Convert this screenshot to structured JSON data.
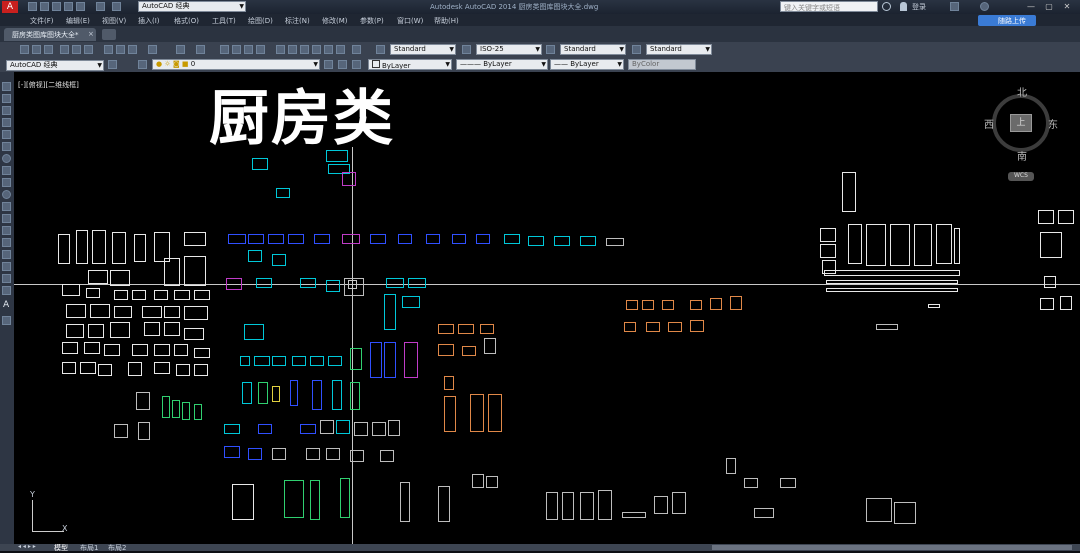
{
  "titlebar": {
    "workspace": "AutoCAD 经典",
    "title": "Autodesk AutoCAD 2014   厨房类图库图块大全.dwg",
    "search_placeholder": "键入关键字或短语",
    "login": "登录"
  },
  "menubar": {
    "items": [
      "文件(F)",
      "编辑(E)",
      "视图(V)",
      "插入(I)",
      "格式(O)",
      "工具(T)",
      "绘图(D)",
      "标注(N)",
      "修改(M)",
      "参数(P)",
      "窗口(W)",
      "帮助(H)"
    ],
    "cloud_button": "随路上传"
  },
  "document_tab": {
    "label": "厨房类图库图块大全*"
  },
  "toolbar1": {
    "text_style": "Standard",
    "dim_style": "ISO-25",
    "table_style": "Standard",
    "mleader_style": "Standard"
  },
  "toolbar2": {
    "workspace": "AutoCAD 经典",
    "layer": "0",
    "color": "ByLayer",
    "linetype": "ByLayer",
    "lineweight": "ByLayer",
    "plotstyle": "ByColor"
  },
  "viewport": {
    "label": "[-][俯视][二维线框]",
    "big_title": "厨房类"
  },
  "viewcube": {
    "north": "北",
    "south": "南",
    "east": "东",
    "west": "西",
    "face": "上",
    "wcs": "WCS"
  },
  "ucs": {
    "x": "X",
    "y": "Y"
  },
  "layout_tabs": [
    "模型",
    "布局1",
    "布局2"
  ],
  "colors": {
    "canvas": "#000000",
    "chrome": "#3a4250",
    "accent": "#3a7bd5"
  }
}
